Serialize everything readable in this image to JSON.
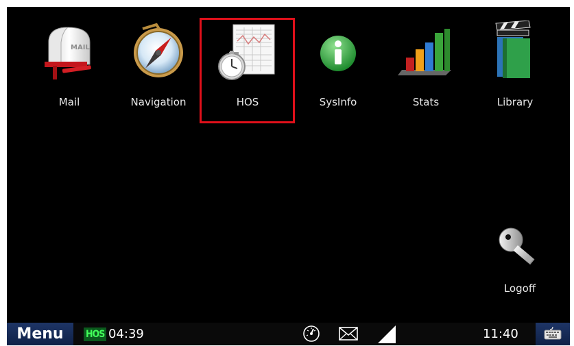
{
  "apps": [
    {
      "name": "Mail",
      "icon": "mailbox-icon"
    },
    {
      "name": "Navigation",
      "icon": "compass-icon"
    },
    {
      "name": "HOS",
      "icon": "logbook-stopwatch-icon"
    },
    {
      "name": "SysInfo",
      "icon": "info-icon"
    },
    {
      "name": "Stats",
      "icon": "bar-chart-icon"
    },
    {
      "name": "Library",
      "icon": "books-clapper-icon"
    }
  ],
  "logoff": {
    "label": "Logoff",
    "icon": "key-icon"
  },
  "taskbar": {
    "menu_label": "Menu",
    "hos_badge": "HOS",
    "hos_time": "04:39",
    "clock": "11:40",
    "icons": [
      "speedometer-icon",
      "envelope-icon",
      "signal-icon",
      "keyboard-icon"
    ]
  },
  "colors": {
    "background": "#000000",
    "highlight": "#e0101a",
    "menu_bar": "#1e3566",
    "hos_badge_bg": "#0b5a1d",
    "hos_badge_text": "#42ff5a"
  }
}
